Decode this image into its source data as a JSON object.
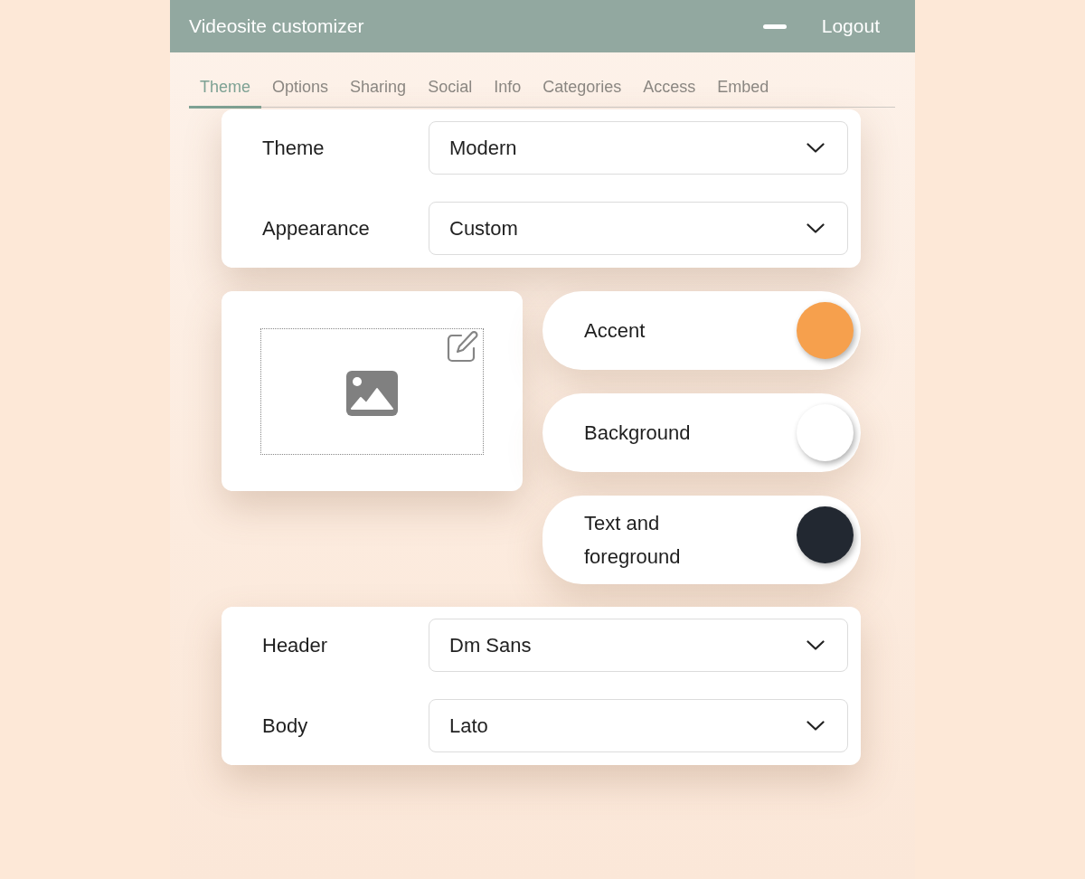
{
  "header": {
    "title": "Videosite customizer",
    "logout": "Logout"
  },
  "tabs": [
    {
      "label": "Theme",
      "selected": true
    },
    {
      "label": "Options",
      "selected": false
    },
    {
      "label": "Sharing",
      "selected": false
    },
    {
      "label": "Social",
      "selected": false
    },
    {
      "label": "Info",
      "selected": false
    },
    {
      "label": "Categories",
      "selected": false
    },
    {
      "label": "Access",
      "selected": false
    },
    {
      "label": "Embed",
      "selected": false
    }
  ],
  "theme_settings": [
    {
      "label": "Theme",
      "value": "Modern"
    },
    {
      "label": "Appearance",
      "value": "Custom"
    }
  ],
  "colors": [
    {
      "label": "Accent",
      "color": "#f6a04d"
    },
    {
      "label": "Background",
      "color": "#ffffff"
    },
    {
      "label": "Text and foreground",
      "color": "#222831"
    }
  ],
  "fonts": [
    {
      "label": "Header",
      "value": "Dm Sans"
    },
    {
      "label": "Body",
      "value": "Lato"
    }
  ]
}
